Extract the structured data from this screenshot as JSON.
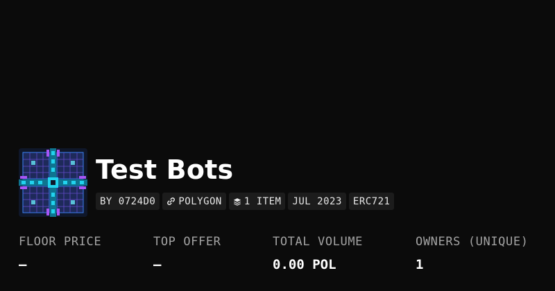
{
  "collection": {
    "name": "Test Bots",
    "avatar_icon": "pixel-robot-grid-art",
    "avatar_colors": [
      "#0f172a",
      "#22d3ee",
      "#a855f7",
      "#3b82f6"
    ]
  },
  "meta_chips": {
    "creator": "BY 0724D0",
    "network": "POLYGON",
    "network_icon": "link-icon",
    "items": "1 ITEM",
    "items_icon": "layers-icon",
    "date": "JUL 2023",
    "standard": "ERC721"
  },
  "stats": {
    "floor_price": {
      "label": "FLOOR PRICE",
      "value": "—"
    },
    "top_offer": {
      "label": "TOP OFFER",
      "value": "—"
    },
    "total_volume": {
      "label": "TOTAL VOLUME",
      "value": "0.00 POL"
    },
    "owners": {
      "label": "OWNERS (UNIQUE)",
      "value": "1"
    }
  },
  "colors": {
    "background": "#0b0b0b",
    "chip_background": "#1c1c1c",
    "label_gray": "#a3a3a3"
  }
}
